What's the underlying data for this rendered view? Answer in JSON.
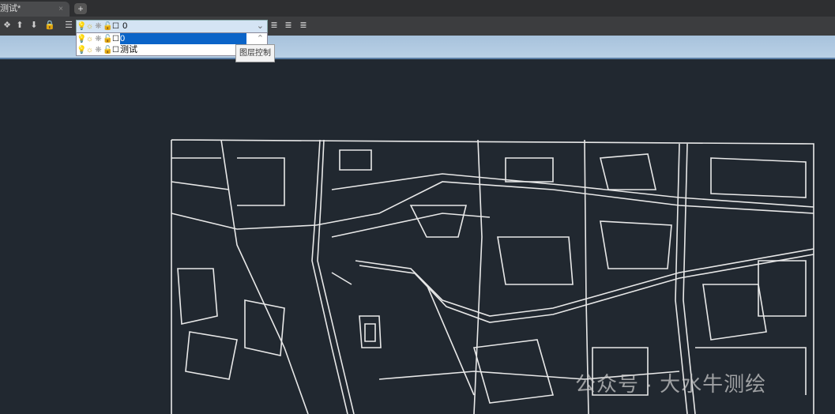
{
  "tab": {
    "title": "测试*",
    "close": "×",
    "new_tab": "+"
  },
  "layer_control": {
    "current_layer": "0",
    "dropdown_arrow": "⌄",
    "scroll_up": "⌃",
    "layers": [
      {
        "name": "0",
        "selected": true
      },
      {
        "name": "测试",
        "selected": false
      }
    ]
  },
  "tooltip": "图层控制",
  "watermark": "公众号 · 大水牛测绘",
  "colors": {
    "canvas": "#212830",
    "selection": "#0a64c8",
    "map_lines": "#e8e8e8"
  }
}
